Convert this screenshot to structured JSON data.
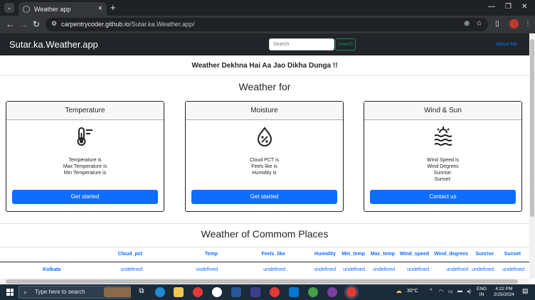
{
  "browser": {
    "tab_title": "Weather app",
    "url_host": "carpentrycoder.github.io",
    "url_path": "/Sutar.ka.Weather.app/"
  },
  "navbar": {
    "brand": "Sutar.ka.Weather.app",
    "search_placeholder": "Search",
    "search_button": "Search",
    "about_link": "About Me"
  },
  "tagline": "Weather Dekhna Hai Aa Jao Dikha Dunga !!",
  "weather_for_title": "Weather for",
  "cards": [
    {
      "title": "Temperature",
      "icon": "thermometer-icon",
      "lines": [
        "Temperature is",
        "Max Temperature is",
        "Min Temperature is"
      ],
      "button": "Get started"
    },
    {
      "title": "Moisture",
      "icon": "humidity-drop-icon",
      "lines": [
        "Cloud PCT is",
        "Feels like is",
        "Humidity is"
      ],
      "button": "Get started"
    },
    {
      "title": "Wind & Sun",
      "icon": "wind-sun-icon",
      "lines": [
        "Wind Speed is",
        "Wind Degrees",
        "Sunrise:",
        "Sunset:"
      ],
      "button": "Contact us"
    }
  ],
  "common_places": {
    "title": "Weather of Commom Places",
    "columns": [
      "Cloud_pct",
      "Temp",
      "Feels_like",
      "Humidity",
      "Min_temp",
      "Max_temp",
      "Wind_speed",
      "Wind_degrees",
      "Sunrise",
      "Sunset"
    ],
    "rows": [
      {
        "place": "Kolkata",
        "values": [
          "undefined",
          "undefined",
          "undefined",
          "undefined",
          "undefined",
          "undefined",
          "undefined",
          "undefined",
          "undefined",
          "undefined"
        ]
      }
    ]
  },
  "taskbar": {
    "search_placeholder": "Type here to search",
    "weather_temp": "30°C",
    "lang_top": "ENG",
    "lang_bottom": "IN",
    "time": "4:22 PM",
    "date": "2/25/2024"
  },
  "colors": {
    "navbar_bg": "#212529",
    "primary": "#0d6efd",
    "success": "#198754"
  }
}
